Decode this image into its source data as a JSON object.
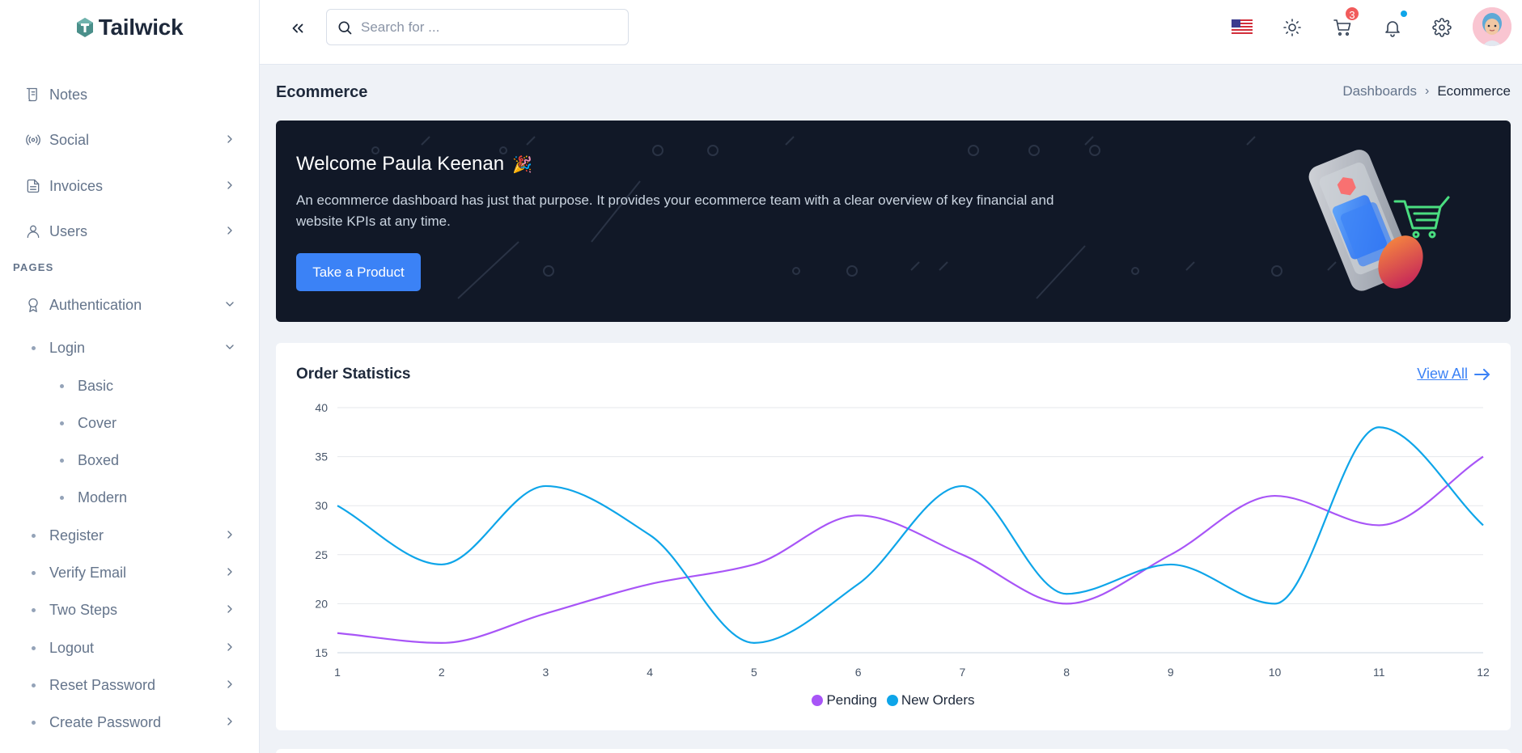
{
  "brand": {
    "name": "Tailwick"
  },
  "sidebar": {
    "items": [
      {
        "label": "Notes"
      },
      {
        "label": "Social"
      },
      {
        "label": "Invoices"
      },
      {
        "label": "Users"
      }
    ],
    "section_label": "PAGES",
    "auth": {
      "label": "Authentication"
    },
    "login": {
      "label": "Login"
    },
    "login_children": [
      {
        "label": "Basic"
      },
      {
        "label": "Cover"
      },
      {
        "label": "Boxed"
      },
      {
        "label": "Modern"
      }
    ],
    "auth_children": [
      {
        "label": "Register"
      },
      {
        "label": "Verify Email"
      },
      {
        "label": "Two Steps"
      },
      {
        "label": "Logout"
      },
      {
        "label": "Reset Password"
      },
      {
        "label": "Create Password"
      }
    ]
  },
  "header": {
    "search_placeholder": "Search for ...",
    "cart_count": "3"
  },
  "page": {
    "title": "Ecommerce",
    "breadcrumb": {
      "parent": "Dashboards",
      "separator": "›",
      "current": "Ecommerce"
    }
  },
  "banner": {
    "greeting": "Welcome Paula Keenan",
    "emoji": "🎉",
    "description": "An ecommerce dashboard has just that purpose. It provides your ecommerce team with a clear overview of key financial and website KPIs at any time.",
    "button_label": "Take a Product"
  },
  "order_stats": {
    "title": "Order Statistics",
    "view_all_label": "View All"
  },
  "colors": {
    "accent": "#3b82f6",
    "pending": "#a855f7",
    "new_orders": "#0ea5e9",
    "banner_bg": "#111827",
    "badge": "#f15b5b"
  },
  "chart_data": {
    "type": "line",
    "x": [
      "1",
      "2",
      "3",
      "4",
      "5",
      "6",
      "7",
      "8",
      "9",
      "10",
      "11",
      "12"
    ],
    "y_ticks": [
      "15",
      "20",
      "25",
      "30",
      "35",
      "40"
    ],
    "ylim": [
      15,
      40
    ],
    "grid": true,
    "legend_position": "bottom",
    "series": [
      {
        "name": "Pending",
        "values": [
          17,
          16,
          19,
          22,
          24,
          29,
          25,
          20,
          25,
          31,
          28,
          35
        ]
      },
      {
        "name": "New Orders",
        "values": [
          30,
          24,
          32,
          27,
          16,
          22,
          32,
          21,
          24,
          20,
          38,
          28
        ]
      }
    ]
  }
}
